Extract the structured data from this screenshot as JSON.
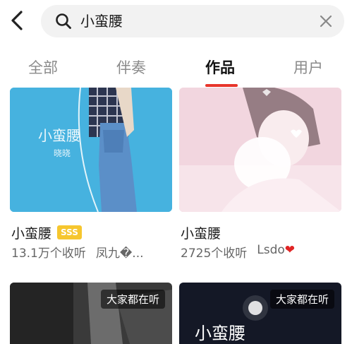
{
  "search": {
    "query": "小蛮腰"
  },
  "tabs": [
    {
      "label": "全部",
      "active": false
    },
    {
      "label": "伴奏",
      "active": false
    },
    {
      "label": "作品",
      "active": true
    },
    {
      "label": "用户",
      "active": false
    }
  ],
  "cards": [
    {
      "title": "小蛮腰",
      "badge": "SSS",
      "listens": "13.1万个收听",
      "author": "凤九�...",
      "cover_text": "小蛮腰",
      "cover_subtext": "晓晓"
    },
    {
      "title": "小蛮腰",
      "listens": "2725个收听",
      "author": "Lsdo",
      "author_emoji": "❤"
    },
    {
      "listen_badge": "大家都在听"
    },
    {
      "listen_badge": "大家都在听",
      "cover_text": "小蛮腰"
    }
  ],
  "colors": {
    "accent": "#e8352b",
    "badge": "#f6c62e",
    "heart": "#e02424"
  },
  "icons": [
    "back-arrow-icon",
    "search-icon",
    "clear-icon"
  ]
}
